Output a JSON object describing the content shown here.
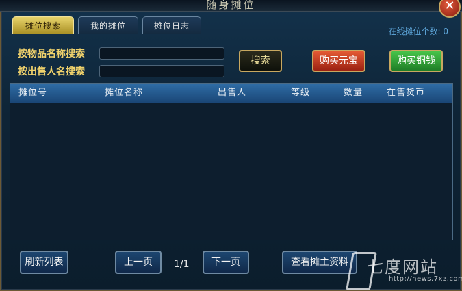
{
  "window": {
    "title": "随身摊位",
    "close_label": "✕"
  },
  "tabs": [
    {
      "label": "摊位搜索",
      "active": true
    },
    {
      "label": "我的摊位",
      "active": false
    },
    {
      "label": "摊位日志",
      "active": false
    }
  ],
  "online_count_text": "在线摊位个数: 0",
  "search": {
    "by_item_label": "按物品名称搜索",
    "by_seller_label": "按出售人名搜索",
    "item_value": "",
    "seller_value": "",
    "search_button": "搜索",
    "buy_yuanbao_button": "购买元宝",
    "buy_tongqian_button": "购买铜钱"
  },
  "table": {
    "columns": [
      "摊位号",
      "摊位名称",
      "出售人",
      "等级",
      "数量",
      "在售货币"
    ],
    "rows": []
  },
  "footer": {
    "refresh_button": "刷新列表",
    "prev_button": "上一页",
    "page_indicator": "1/1",
    "next_button": "下一页",
    "view_owner_button": "查看摊主资料"
  },
  "watermark": {
    "brand": "七度网站",
    "url": "http://news.7xz.com"
  },
  "colors": {
    "accent_gold": "#f0d26c",
    "online_blue": "#5fa8dc",
    "red_button": "#c8361f",
    "green_button": "#2f9e36"
  }
}
